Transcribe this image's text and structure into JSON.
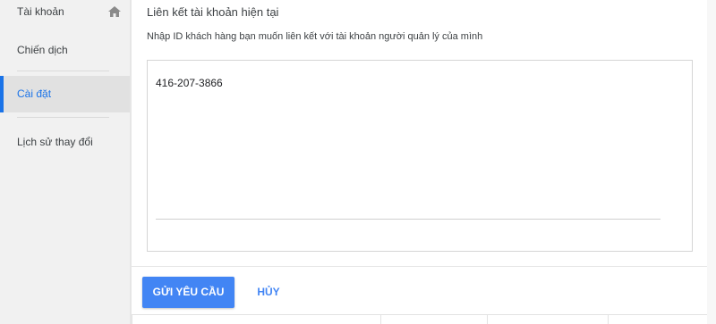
{
  "sidebar": {
    "home_label": "Tài khoản",
    "home_icon": "home-icon",
    "campaigns_label": "Chiến dịch",
    "settings_label": "Cài đặt",
    "history_label": "Lịch sử thay đổi"
  },
  "main": {
    "title": "Liên kết tài khoản hiện tại",
    "subtitle": "Nhập ID khách hàng bạn muốn liên kết với tài khoản người quản lý của mình",
    "customer_ids_value": "416-207-3866"
  },
  "actions": {
    "submit_label": "GỬI YÊU CẦU",
    "cancel_label": "HỦY"
  },
  "colors": {
    "accent": "#4285f4",
    "active_nav": "#1a73e8",
    "sidebar_bg": "#f1f1f1"
  }
}
